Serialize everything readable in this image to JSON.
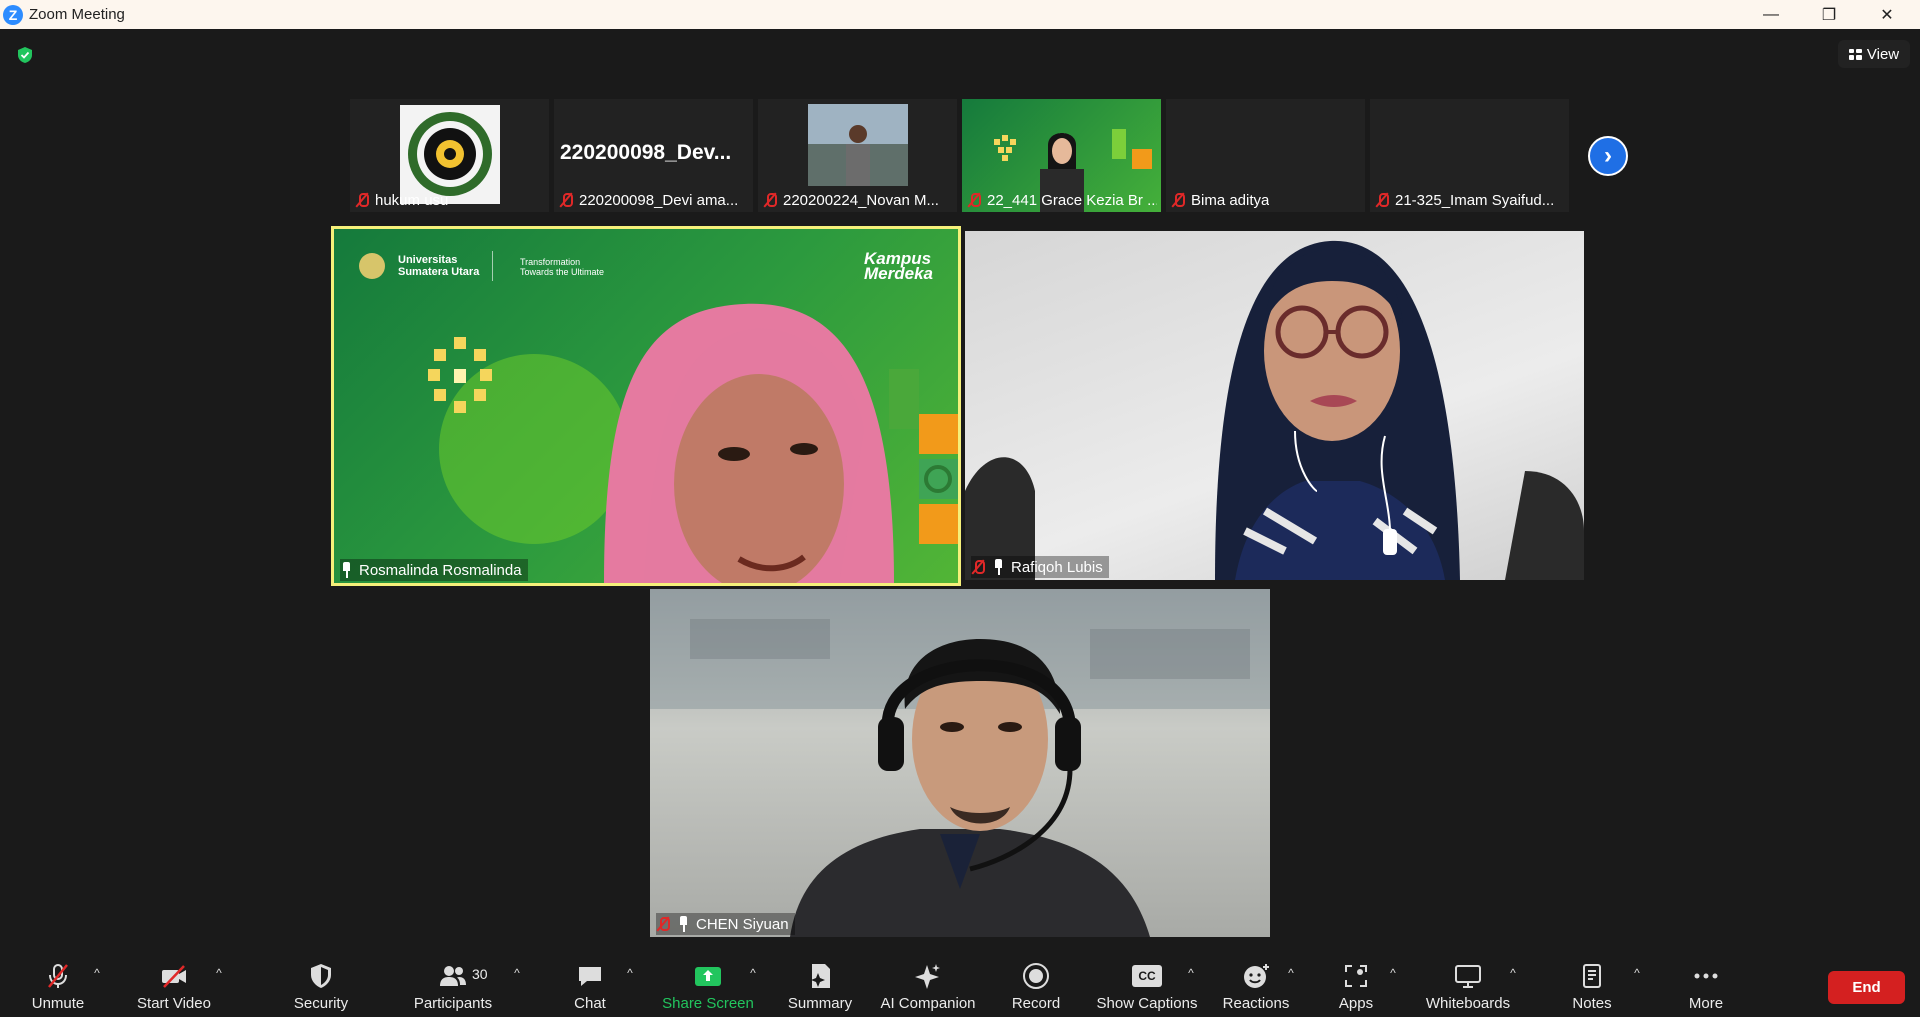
{
  "window": {
    "logo_letter": "Z",
    "title": "Zoom Meeting",
    "minimize_glyph": "—",
    "restore_glyph": "❐",
    "close_glyph": "✕"
  },
  "view_button": {
    "label": "View"
  },
  "thumbnails": [
    {
      "name": "hukum usu",
      "muted": true,
      "content": "logo-image"
    },
    {
      "name": "220200098_Devi ama...",
      "muted": true,
      "display_name": "220200098_Dev..."
    },
    {
      "name": "220200224_Novan M...",
      "muted": true,
      "content": "photo"
    },
    {
      "name": "22_441 Grace Kezia Br ...",
      "muted": true,
      "content": "video"
    },
    {
      "name": "Bima aditya",
      "muted": true
    },
    {
      "name": "21-325_Imam Syaifud...",
      "muted": true
    }
  ],
  "next_page_glyph": "›",
  "tiles": {
    "rosmalinda": {
      "name": "Rosmalinda Rosmalinda",
      "muted": false,
      "pinned": true,
      "active_speaker": true
    },
    "rafiqoh": {
      "name": "Rafiqoh Lubis",
      "muted": true,
      "pinned": true
    },
    "chen": {
      "name": "CHEN Siyuan",
      "muted": true,
      "pinned": true
    }
  },
  "background_branding": {
    "university_line1": "Universitas",
    "university_line2": "Sumatera Utara",
    "tagline_line1": "Transformation",
    "tagline_line2": "Towards the Ultimate",
    "kampus_line1": "Kampus",
    "kampus_line2": "Merdeka"
  },
  "toolbar": {
    "unmute": "Unmute",
    "start_video": "Start Video",
    "security": "Security",
    "participants": "Participants",
    "participants_count": "30",
    "chat": "Chat",
    "share_screen": "Share Screen",
    "summary": "Summary",
    "ai_companion": "AI Companion",
    "record": "Record",
    "show_captions": "Show Captions",
    "captions_icon_text": "CC",
    "reactions": "Reactions",
    "apps": "Apps",
    "whiteboards": "Whiteboards",
    "notes": "Notes",
    "more": "More",
    "end": "End",
    "caret_glyph": "^"
  },
  "colors": {
    "accent_blue": "#2d8cff",
    "share_green": "#22c55e",
    "end_red": "#d42020",
    "speaker_border": "#f5f07a",
    "muted_red": "#e02828"
  }
}
